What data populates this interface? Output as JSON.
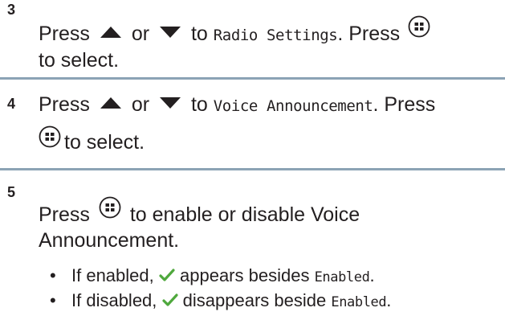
{
  "steps": [
    {
      "number": "3",
      "line1": {
        "a": "Press",
        "b": "or",
        "c": "to",
        "menu": "Radio Settings",
        "d": ". Press"
      },
      "line2": "to select."
    },
    {
      "number": "4",
      "line1": {
        "a": "Press",
        "b": "or",
        "c": "to",
        "menu": "Voice Announcement",
        "d": ". Press"
      },
      "line2": "to select."
    },
    {
      "number": "5",
      "line1": {
        "a": "Press",
        "b": "to enable or disable Voice"
      },
      "line2": "Announcement.",
      "bullets": [
        {
          "dot": "•",
          "a": "If enabled,",
          "b": "appears besides",
          "menu": "Enabled",
          "end": "."
        },
        {
          "dot": "•",
          "a": "If disabled,",
          "b": "disappears beside",
          "menu": "Enabled",
          "end": "."
        }
      ]
    }
  ],
  "icons": {
    "up": "up-arrow-icon",
    "down": "down-arrow-icon",
    "ok": "menu-ok-button-icon",
    "check": "checkmark-icon"
  },
  "colors": {
    "text": "#231f20",
    "divider": "#8ca3b5",
    "check": "#4fa83d"
  }
}
